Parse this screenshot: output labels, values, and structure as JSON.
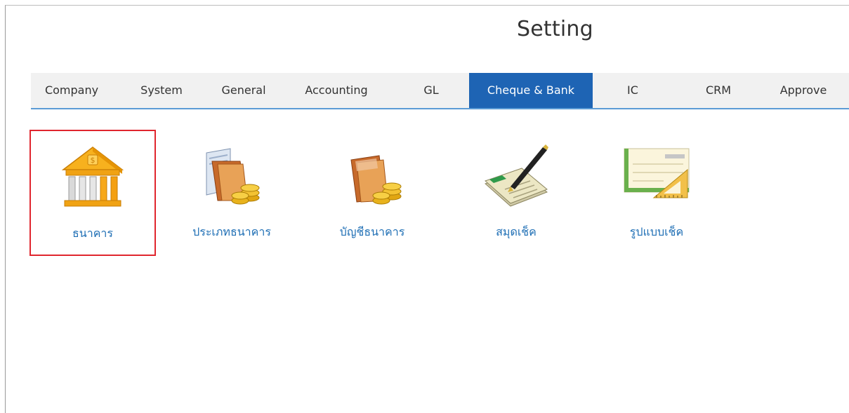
{
  "page": {
    "title": "Setting"
  },
  "tabs": [
    {
      "label": "Company",
      "active": false
    },
    {
      "label": "System",
      "active": false
    },
    {
      "label": "General",
      "active": false
    },
    {
      "label": "Accounting",
      "active": false
    },
    {
      "label": "GL",
      "active": false
    },
    {
      "label": "Cheque & Bank",
      "active": true
    },
    {
      "label": "IC",
      "active": false
    },
    {
      "label": "CRM",
      "active": false
    },
    {
      "label": "Approve",
      "active": false
    }
  ],
  "tiles": [
    {
      "label": "ธนาคาร",
      "icon": "bank-building-icon",
      "selected": true
    },
    {
      "label": "ประเภทธนาคาร",
      "icon": "bank-type-folder-coins-icon",
      "selected": false
    },
    {
      "label": "บัญชีธนาคาร",
      "icon": "bank-account-folder-coins-icon",
      "selected": false
    },
    {
      "label": "สมุดเช็ค",
      "icon": "chequebook-pen-icon",
      "selected": false
    },
    {
      "label": "รูปแบบเช็ค",
      "icon": "cheque-format-ruler-icon",
      "selected": false
    }
  ],
  "colors": {
    "active_tab": "#1e64b4",
    "tab_underline": "#5b9bd5",
    "tile_label": "#1f6fb5",
    "selection_border": "#e0262e"
  }
}
